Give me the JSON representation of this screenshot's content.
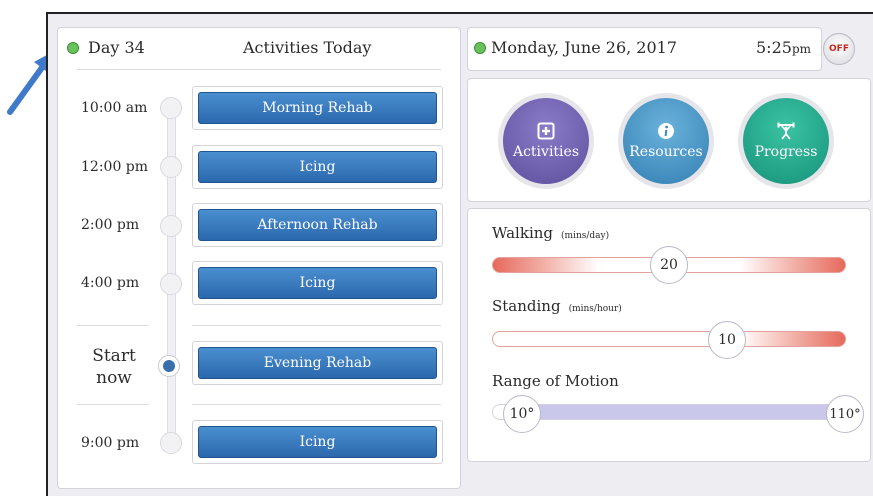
{
  "day_label": "Day 34",
  "activities_title": "Activities Today",
  "date_label": "Monday, June 26, 2017",
  "time_label": "5:25",
  "time_suffix": "pm",
  "power_button_label": "OFF",
  "colors": {
    "status_green": "#69c25c",
    "button_blue": "#2b68ad",
    "activities_purple": "#6f5fae",
    "resources_blue": "#3f8fbe",
    "progress_teal": "#1fa287",
    "slider_red": "#e6695c",
    "range_fill": "#c9c7ea"
  },
  "schedule": [
    {
      "time": "10:00 am",
      "activity": "Morning Rehab"
    },
    {
      "time": "12:00 pm",
      "activity": "Icing"
    },
    {
      "time": "2:00 pm",
      "activity": "Afternoon Rehab"
    },
    {
      "time": "4:00 pm",
      "activity": "Icing"
    },
    {
      "time_line1": "Start",
      "time_line2": "now",
      "activity": "Evening Rehab",
      "current": true
    },
    {
      "time": "9:00 pm",
      "activity": "Icing"
    }
  ],
  "nav_buttons": [
    {
      "label": "Activities",
      "icon": "plus-square-icon"
    },
    {
      "label": "Resources",
      "icon": "info-icon"
    },
    {
      "label": "Progress",
      "icon": "weightlifter-icon"
    }
  ],
  "sliders": {
    "walking": {
      "label": "Walking",
      "unit": "(mins/day)",
      "value": "20"
    },
    "standing": {
      "label": "Standing",
      "unit": "(mins/hour)",
      "value": "10"
    },
    "range_of_motion": {
      "label": "Range of Motion",
      "min_value": "10°",
      "max_value": "110°"
    }
  }
}
